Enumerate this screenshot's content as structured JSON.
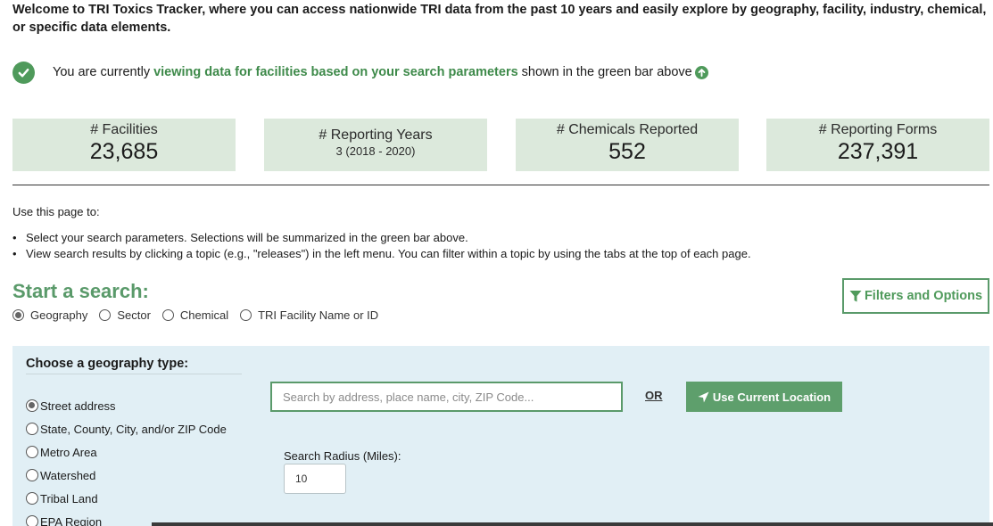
{
  "header": {
    "welcome": "Welcome to TRI Toxics Tracker, where you can access nationwide TRI data from the past 10 years and easily explore by geography, facility, industry, chemical, or specific data elements."
  },
  "status": {
    "prefix": "You are currently",
    "highlight": "viewing data for facilities based on your search parameters",
    "suffix": "shown in the green bar above"
  },
  "stats": {
    "facilities": {
      "label": "# Facilities",
      "value": "23,685"
    },
    "years": {
      "label": "# Reporting Years",
      "value": "3 (2018 - 2020)"
    },
    "chemicals": {
      "label": "# Chemicals Reported",
      "value": "552"
    },
    "forms": {
      "label": "# Reporting Forms",
      "value": "237,391"
    }
  },
  "instructions": {
    "intro": "Use this page to:",
    "bullets": [
      "Select your search parameters. Selections will be summarized in the green bar above.",
      "View search results by clicking a topic (e.g., \"releases\") in the left menu. You can filter within a topic by using the tabs at the top of each page."
    ]
  },
  "search": {
    "title": "Start a search:",
    "filters_label": "Filters and Options",
    "types": [
      {
        "label": "Geography",
        "selected": true
      },
      {
        "label": "Sector",
        "selected": false
      },
      {
        "label": "Chemical",
        "selected": false
      },
      {
        "label": "TRI Facility Name or ID",
        "selected": false
      }
    ]
  },
  "geography": {
    "title": "Choose a geography type:",
    "options": [
      {
        "label": "Street address",
        "selected": true
      },
      {
        "label": "State, County, City, and/or ZIP Code",
        "selected": false
      },
      {
        "label": "Metro Area",
        "selected": false
      },
      {
        "label": "Watershed",
        "selected": false
      },
      {
        "label": "Tribal Land",
        "selected": false
      },
      {
        "label": "EPA Region",
        "selected": false
      }
    ],
    "search_placeholder": "Search by address, place name, city, ZIP Code...",
    "search_value": "",
    "or_label": "OR",
    "location_button": "Use Current Location",
    "radius_label": "Search Radius (Miles):",
    "radius_value": "10"
  },
  "colors": {
    "accent_green": "#5a9a6a",
    "stat_bg": "#dce9dc",
    "panel_bg": "#e1eff5"
  }
}
